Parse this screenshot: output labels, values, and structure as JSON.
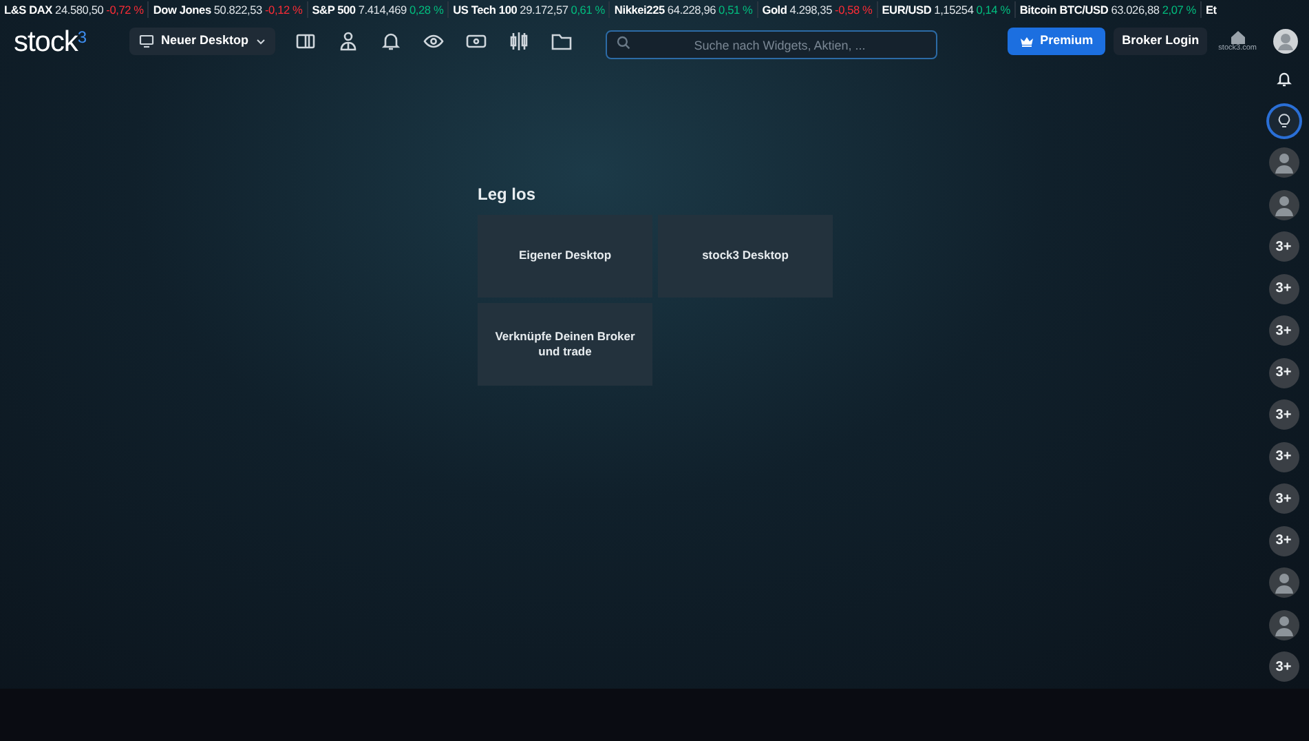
{
  "ticker": [
    {
      "name": "L&S DAX",
      "value": "24.580,50",
      "change": "-0,72 %",
      "negative": true
    },
    {
      "name": "Dow Jones",
      "value": "50.822,53",
      "change": "-0,12 %",
      "negative": true
    },
    {
      "name": "S&P 500",
      "value": "7.414,469",
      "change": "0,28 %",
      "negative": false
    },
    {
      "name": "US Tech 100",
      "value": "29.172,57",
      "change": "0,61 %",
      "negative": false
    },
    {
      "name": "Nikkei225",
      "value": "64.228,96",
      "change": "0,51 %",
      "negative": false
    },
    {
      "name": "Gold",
      "value": "4.298,35",
      "change": "-0,58 %",
      "negative": true
    },
    {
      "name": "EUR/USD",
      "value": "1,15254",
      "change": "0,14 %",
      "negative": false
    },
    {
      "name": "Bitcoin BTC/USD",
      "value": "63.026,88",
      "change": "2,07 %",
      "negative": false
    },
    {
      "name": "Et"
    }
  ],
  "logo": {
    "text": "stock",
    "sup": "3"
  },
  "desktop_button": {
    "label": "Neuer Desktop"
  },
  "search": {
    "placeholder": "Suche nach Widgets, Aktien, ..."
  },
  "premium_button": {
    "label": "Premium"
  },
  "broker_button": {
    "label": "Broker Login"
  },
  "home_link": {
    "label": "stock3.com"
  },
  "start": {
    "title": "Leg los",
    "cards": [
      "Eigener Desktop",
      "stock3 Desktop",
      "Verknüpfe Deinen Broker und trade"
    ]
  },
  "sidebar": [
    {
      "kind": "bell",
      "selected": false
    },
    {
      "kind": "idea",
      "selected": true
    },
    {
      "kind": "avatar",
      "selected": false
    },
    {
      "kind": "avatar",
      "selected": false
    },
    {
      "kind": "plus",
      "label": "3+",
      "selected": false
    },
    {
      "kind": "plus",
      "label": "3+",
      "selected": false
    },
    {
      "kind": "plus",
      "label": "3+",
      "selected": false
    },
    {
      "kind": "plus",
      "label": "3+",
      "selected": false
    },
    {
      "kind": "plus",
      "label": "3+",
      "selected": false
    },
    {
      "kind": "plus",
      "label": "3+",
      "selected": false
    },
    {
      "kind": "plus",
      "label": "3+",
      "selected": false
    },
    {
      "kind": "plus",
      "label": "3+",
      "selected": false
    },
    {
      "kind": "avatar",
      "selected": false
    },
    {
      "kind": "avatar",
      "selected": false
    },
    {
      "kind": "plus",
      "label": "3+",
      "selected": false
    }
  ]
}
